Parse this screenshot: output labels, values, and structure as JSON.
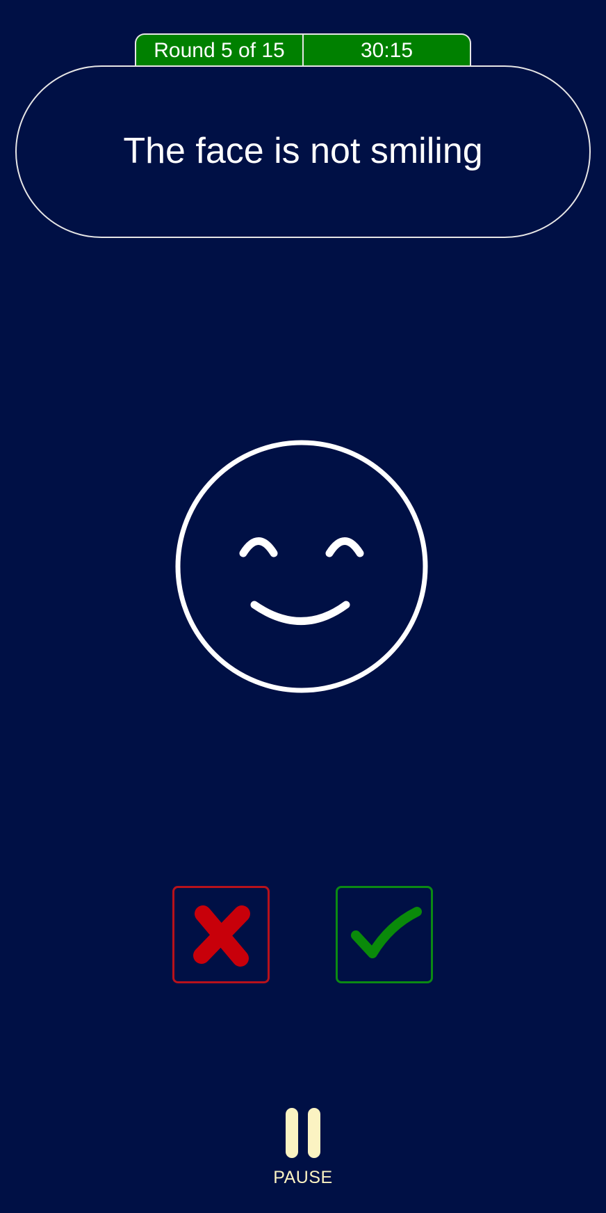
{
  "status": {
    "round_label": "Round 5 of 15",
    "timer": "30:15"
  },
  "prompt": {
    "text": "The face is not smiling"
  },
  "stimulus": {
    "icon": "smiling-face-icon",
    "expression": "smiling"
  },
  "answers": {
    "reject": {
      "icon": "red-x-icon",
      "color": "#c8000a"
    },
    "accept": {
      "icon": "green-checkmark-icon",
      "color": "#0a8a0a"
    }
  },
  "controls": {
    "pause_label": "PAUSE",
    "pause_icon": "pause-icon"
  },
  "colors": {
    "background": "#001045",
    "status_bar": "#008000",
    "pause": "#fbf3c2"
  }
}
